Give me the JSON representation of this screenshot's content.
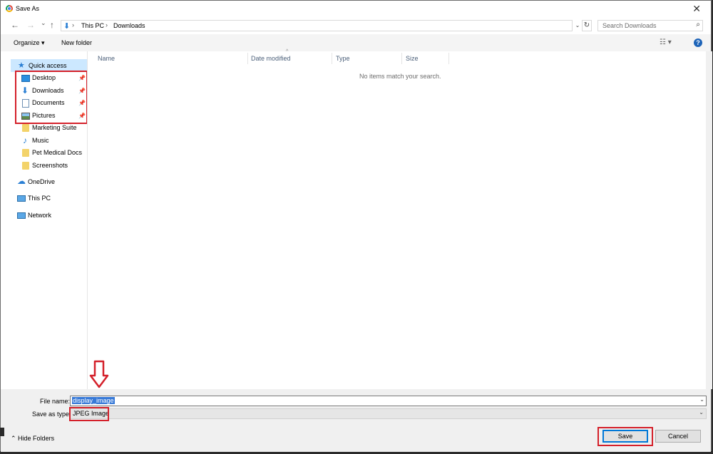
{
  "window": {
    "title": "Save As",
    "close_glyph": "✕"
  },
  "nav_buttons": {
    "back": "←",
    "forward": "→",
    "recent": "⌄",
    "up": "↑"
  },
  "address": {
    "crumbs": [
      "This PC",
      "Downloads"
    ],
    "separator": "›"
  },
  "search": {
    "placeholder": "Search Downloads"
  },
  "toolbar": {
    "organize": "Organize ▾",
    "new_folder": "New folder",
    "view_glyph": "☷ ▾",
    "help": "?"
  },
  "sidebar": {
    "quick_access": "Quick access",
    "pinned": [
      "Desktop",
      "Downloads",
      "Documents",
      "Pictures"
    ],
    "folders": [
      "Marketing Suite",
      "Music",
      "Pet Medical Docs",
      "Screenshots"
    ],
    "onedrive": "OneDrive",
    "this_pc": "This PC",
    "network": "Network"
  },
  "columns": [
    "Name",
    "Date modified",
    "Type",
    "Size"
  ],
  "empty_message": "No items match your search.",
  "form": {
    "file_name_label": "File name:",
    "file_name_value": "display_image",
    "type_label": "Save as type:",
    "type_value": "JPEG Image"
  },
  "footer": {
    "hide_folders": "Hide Folders",
    "save": "Save",
    "cancel": "Cancel"
  },
  "colors": {
    "highlight_red": "#d4202a",
    "selection_blue": "#3779d7",
    "accent_blue": "#0078d7"
  }
}
